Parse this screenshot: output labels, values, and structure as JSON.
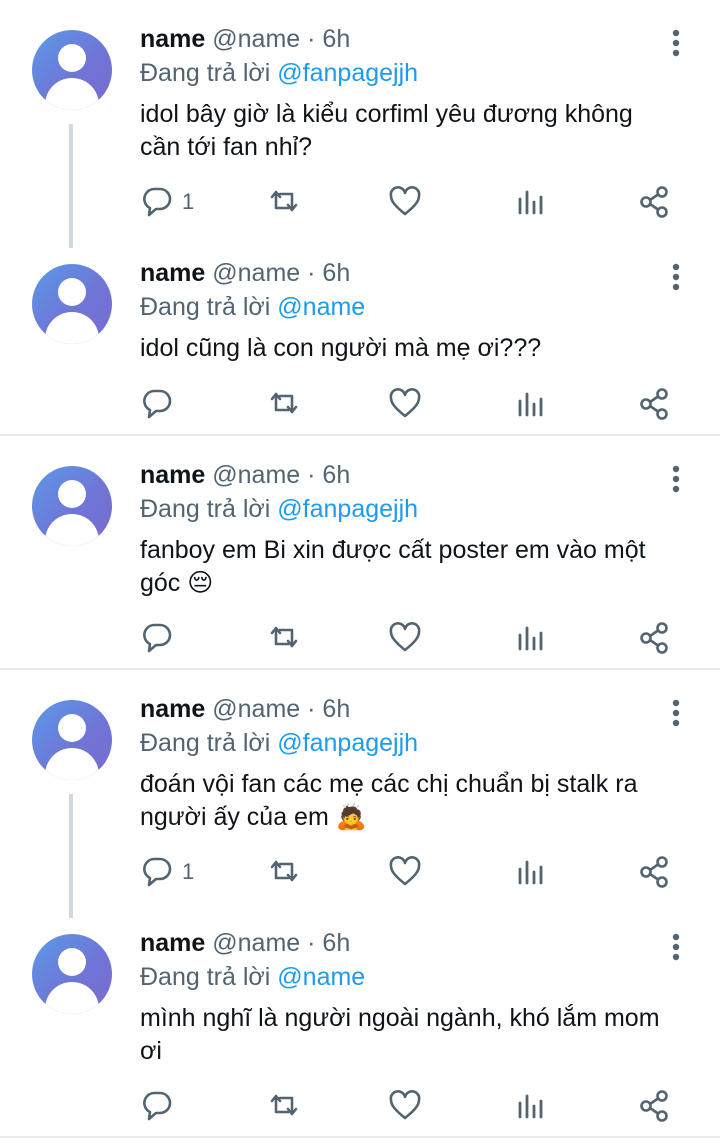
{
  "tweets": [
    {
      "name": "name",
      "handle": "@name",
      "dot": "·",
      "time": "6h",
      "replying_label": "Đang trả lời",
      "replying_to": "@fanpagejjh",
      "text": "idol bây giờ là kiểu corfiml yêu đương không cần tới fan nhỉ?",
      "reply_count": "1"
    },
    {
      "name": "name",
      "handle": "@name",
      "dot": "·",
      "time": "6h",
      "replying_label": "Đang trả lời",
      "replying_to": "@name",
      "text": "idol cũng là con người mà mẹ ơi???",
      "reply_count": ""
    },
    {
      "name": "name",
      "handle": "@name",
      "dot": "·",
      "time": "6h",
      "replying_label": "Đang trả lời",
      "replying_to": "@fanpagejjh",
      "text": "fanboy em Bi xin được cất poster em vào một góc",
      "emoji": "😔",
      "reply_count": ""
    },
    {
      "name": "name",
      "handle": "@name",
      "dot": "·",
      "time": "6h",
      "replying_label": "Đang trả lời",
      "replying_to": "@fanpagejjh",
      "text": "đoán vội fan các mẹ các chị chuẩn bị stalk ra người ấy của em",
      "emoji": "🙇",
      "reply_count": "1"
    },
    {
      "name": "name",
      "handle": "@name",
      "dot": "·",
      "time": "6h",
      "replying_label": "Đang trả lời",
      "replying_to": "@name",
      "text": "mình nghĩ là người ngoài ngành, khó lắm mom ơi",
      "reply_count": ""
    }
  ],
  "icons": {
    "reply": "reply-icon",
    "retweet": "retweet-icon",
    "like": "heart-icon",
    "analytics": "analytics-icon",
    "share": "share-icon",
    "more": "more-vertical-icon"
  },
  "colors": {
    "mention": "#1d9bf0",
    "secondary_text": "#536471",
    "thread_line": "#cfd9de",
    "divider": "#e6ecf0"
  }
}
